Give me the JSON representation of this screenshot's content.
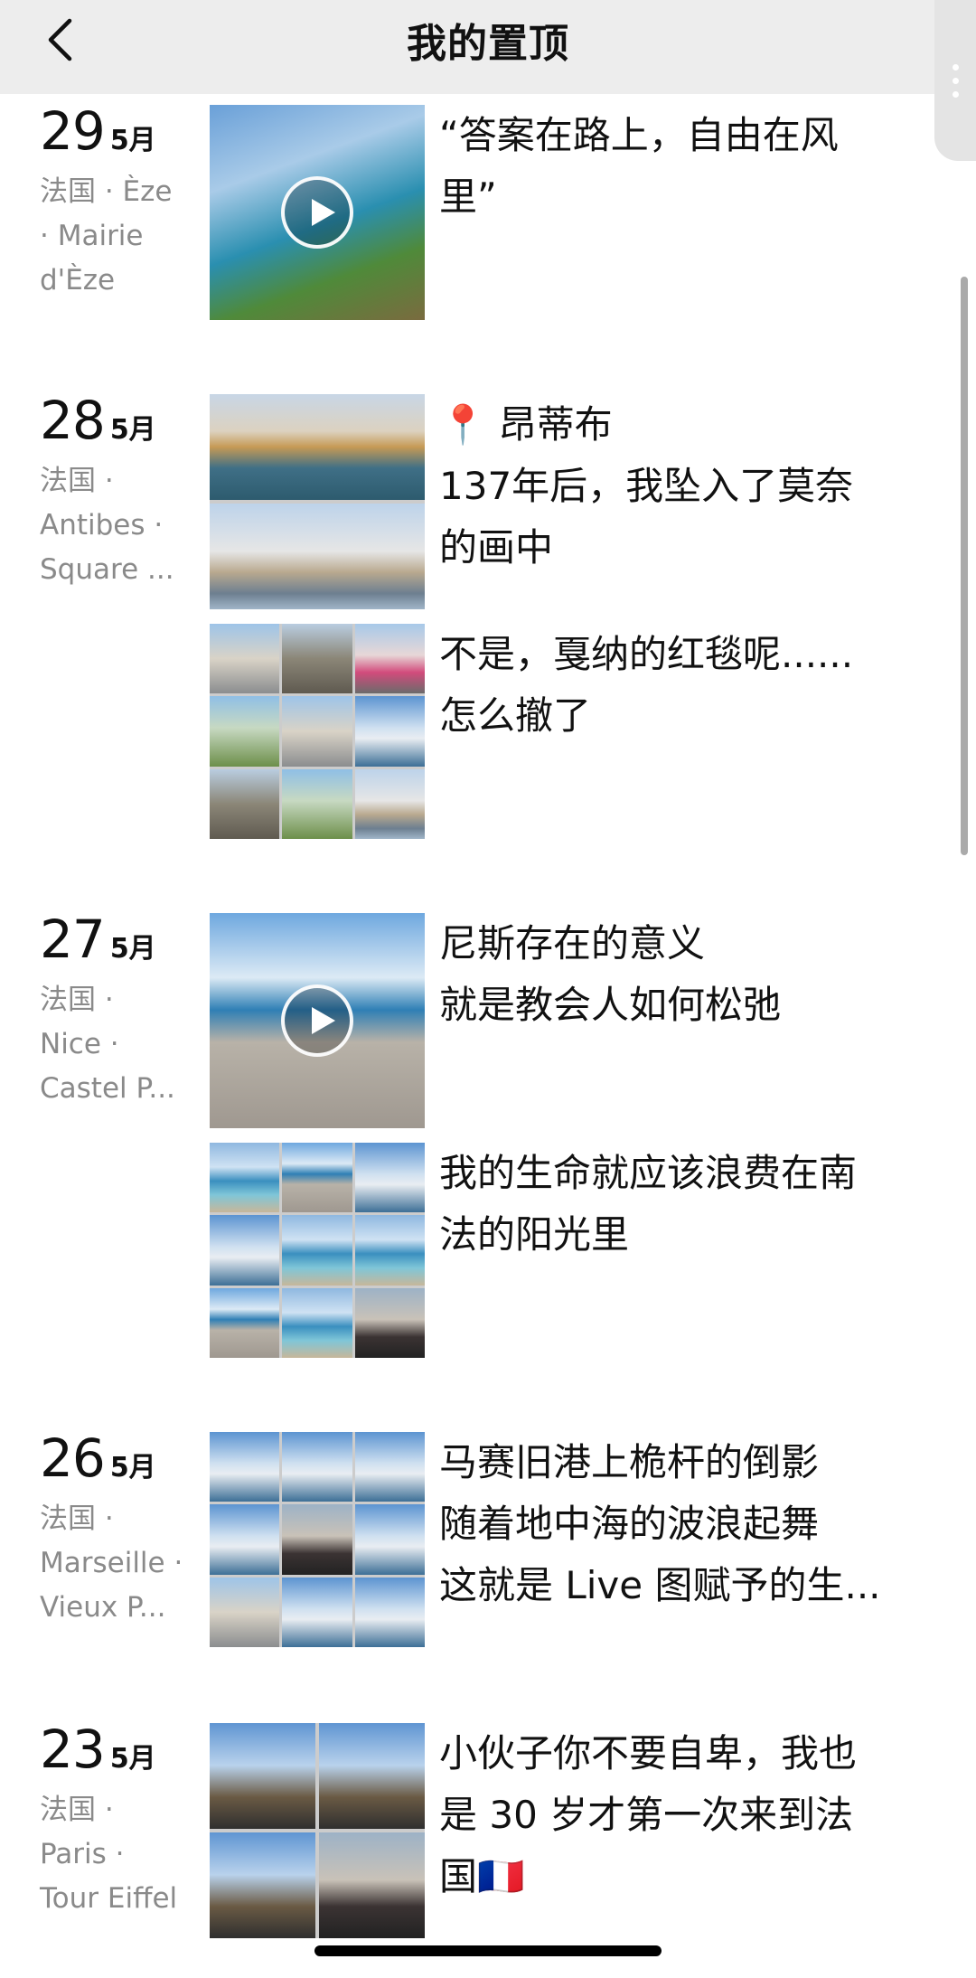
{
  "header": {
    "title": "我的置顶",
    "back_icon": "chevron-left-icon"
  },
  "entries": [
    {
      "day": "29",
      "month": "5月",
      "location": [
        "法国 · Èze",
        "· Mairie",
        "d'Èze"
      ],
      "posts": [
        {
          "media": "video",
          "text": "“答案在路上，自由在风\n里”"
        }
      ]
    },
    {
      "day": "28",
      "month": "5月",
      "location": [
        "法国 ·",
        "Antibes ·",
        "Square ..."
      ],
      "posts": [
        {
          "media": "photos-2",
          "pin_icon": "📍",
          "text": " 昂蒂布\n137年后，我坠入了莫奈\n的画中"
        },
        {
          "media": "photos-9",
          "text": "不是，戛纳的红毯呢......\n怎么撤了"
        }
      ]
    },
    {
      "day": "27",
      "month": "5月",
      "location": [
        "法国 ·",
        "Nice ·",
        "Castel P..."
      ],
      "posts": [
        {
          "media": "video",
          "text": "尼斯存在的意义\n就是教会人如何松弛"
        },
        {
          "media": "photos-9",
          "text": "我的生命就应该浪费在南\n法的阳光里"
        }
      ]
    },
    {
      "day": "26",
      "month": "5月",
      "location": [
        "法国 ·",
        "Marseille ·",
        " Vieux P..."
      ],
      "posts": [
        {
          "media": "photos-9",
          "text": "马赛旧港上桅杆的倒影\n随着地中海的波浪起舞\n这就是 Live 图赋予的生..."
        }
      ]
    },
    {
      "day": "23",
      "month": "5月",
      "location": [
        "法国 ·",
        "Paris ·",
        "Tour Eiffel"
      ],
      "posts": [
        {
          "media": "photos-4",
          "text": "小伙子你不要自卑，我也\n是 30 岁才第一次来到法\n国",
          "flag": "🇫🇷"
        }
      ]
    }
  ]
}
